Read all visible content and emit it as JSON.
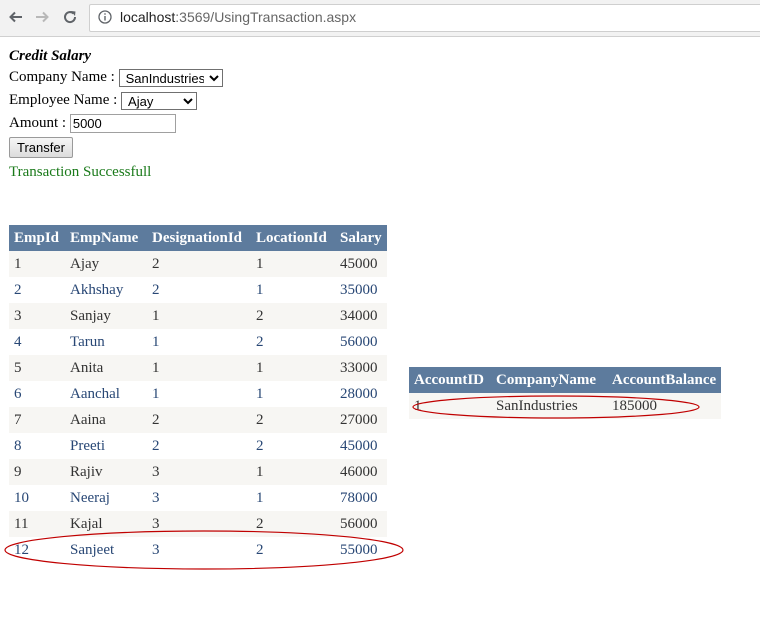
{
  "browser": {
    "url_host": "localhost",
    "url_rest": ":3569/UsingTransaction.aspx"
  },
  "form": {
    "title": "Credit Salary",
    "company_label": "Company Name :",
    "company_selected": "SanIndustries",
    "employee_label": "Employee Name :",
    "employee_selected": "Ajay",
    "amount_label": "Amount :",
    "amount_value": "5000",
    "transfer_label": "Transfer",
    "status_message": "Transaction Successfull"
  },
  "employee_grid": {
    "headers": [
      "EmpId",
      "EmpName",
      "DesignationId",
      "LocationId",
      "Salary"
    ],
    "rows": [
      [
        "1",
        "Ajay",
        "2",
        "1",
        "45000"
      ],
      [
        "2",
        "Akhshay",
        "2",
        "1",
        "35000"
      ],
      [
        "3",
        "Sanjay",
        "1",
        "2",
        "34000"
      ],
      [
        "4",
        "Tarun",
        "1",
        "2",
        "56000"
      ],
      [
        "5",
        "Anita",
        "1",
        "1",
        "33000"
      ],
      [
        "6",
        "Aanchal",
        "1",
        "1",
        "28000"
      ],
      [
        "7",
        "Aaina",
        "2",
        "2",
        "27000"
      ],
      [
        "8",
        "Preeti",
        "2",
        "2",
        "45000"
      ],
      [
        "9",
        "Rajiv",
        "3",
        "1",
        "46000"
      ],
      [
        "10",
        "Neeraj",
        "3",
        "1",
        "78000"
      ],
      [
        "11",
        "Kajal",
        "3",
        "2",
        "56000"
      ],
      [
        "12",
        "Sanjeet",
        "3",
        "2",
        "55000"
      ]
    ]
  },
  "account_grid": {
    "headers": [
      "AccountID",
      "CompanyName",
      "AccountBalance"
    ],
    "rows": [
      [
        "1",
        "SanIndustries",
        "185000"
      ]
    ]
  },
  "colors": {
    "grid_header": "#5d7b9d",
    "row_odd": "#f7f6f3",
    "row_even": "#ffffff",
    "status_text": "#1a7a1a",
    "highlight_ellipse": "#c00000"
  }
}
